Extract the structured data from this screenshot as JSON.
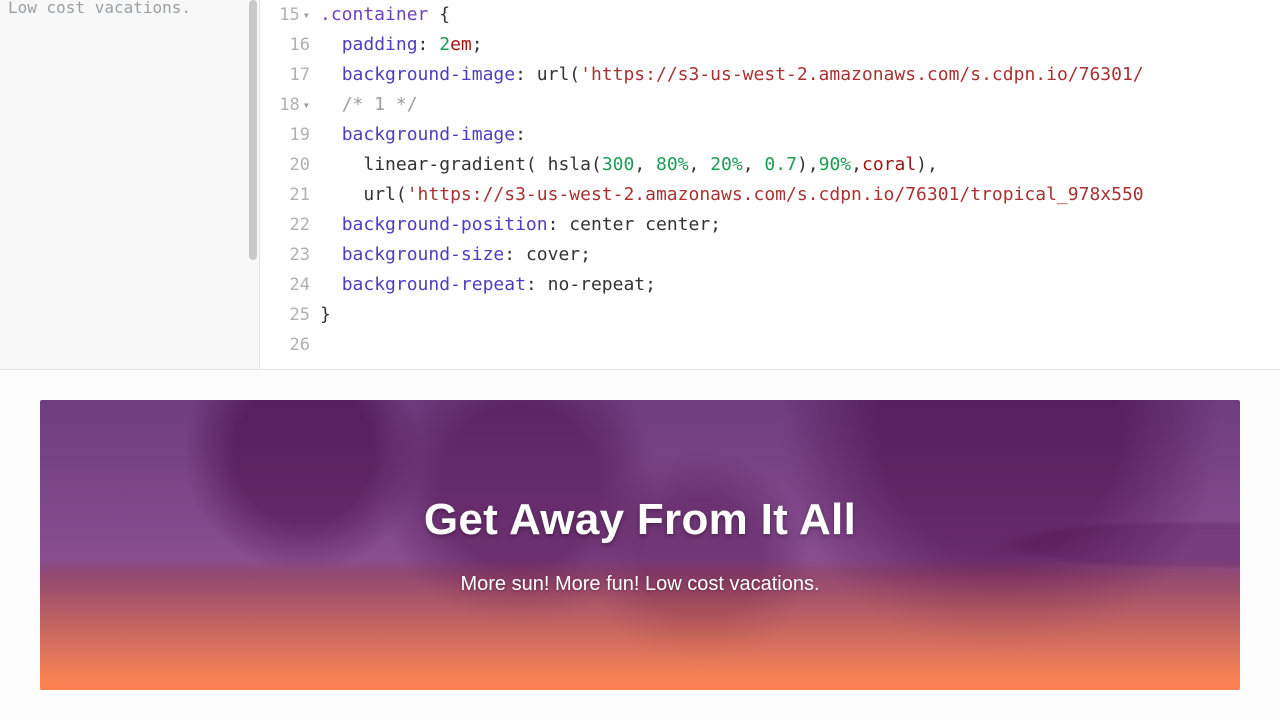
{
  "left_panel": {
    "visible_fragment": "Low cost vacations."
  },
  "editor": {
    "lines": [
      {
        "n": 15,
        "fold": true,
        "tokens": [
          [
            ".container",
            " sel"
          ],
          [
            " {",
            "punct"
          ]
        ]
      },
      {
        "n": 16,
        "fold": false,
        "tokens": [
          [
            "  ",
            ""
          ],
          [
            "padding",
            "prop"
          ],
          [
            ": ",
            "punct"
          ],
          [
            "2",
            "num"
          ],
          [
            "em",
            "unit"
          ],
          [
            ";",
            "punct"
          ]
        ]
      },
      {
        "n": 17,
        "fold": false,
        "tokens": [
          [
            "  ",
            ""
          ],
          [
            "background-image",
            "prop"
          ],
          [
            ": ",
            "punct"
          ],
          [
            "url",
            "fn"
          ],
          [
            "(",
            "punct"
          ],
          [
            "'https://s3-us-west-2.amazonaws.com/s.cdpn.io/76301/",
            "str"
          ]
        ]
      },
      {
        "n": 18,
        "fold": true,
        "tokens": [
          [
            "  ",
            ""
          ],
          [
            "/* 1 */",
            "comment"
          ]
        ]
      },
      {
        "n": 19,
        "fold": false,
        "tokens": [
          [
            "  ",
            ""
          ],
          [
            "background-image",
            "prop"
          ],
          [
            ":",
            "punct"
          ]
        ]
      },
      {
        "n": 20,
        "fold": false,
        "tokens": [
          [
            "    ",
            ""
          ],
          [
            "linear-gradient",
            "fn"
          ],
          [
            "( ",
            "punct"
          ],
          [
            "hsla",
            "fn"
          ],
          [
            "(",
            "punct"
          ],
          [
            "300",
            "num"
          ],
          [
            ", ",
            "punct"
          ],
          [
            "80%",
            "num"
          ],
          [
            ", ",
            "punct"
          ],
          [
            "20%",
            "num"
          ],
          [
            ", ",
            "punct"
          ],
          [
            "0.7",
            "num"
          ],
          [
            ")",
            "punct"
          ],
          [
            ",",
            "punct"
          ],
          [
            "90%",
            "num"
          ],
          [
            ",",
            "punct"
          ],
          [
            "coral",
            "val"
          ],
          [
            ")",
            "punct"
          ],
          [
            ",",
            "punct"
          ]
        ]
      },
      {
        "n": 21,
        "fold": false,
        "tokens": [
          [
            "    ",
            ""
          ],
          [
            "url",
            "fn"
          ],
          [
            "(",
            "punct"
          ],
          [
            "'https://s3-us-west-2.amazonaws.com/s.cdpn.io/76301/tropical_978x550",
            "str"
          ]
        ]
      },
      {
        "n": 22,
        "fold": false,
        "tokens": [
          [
            "  ",
            ""
          ],
          [
            "background-position",
            "prop"
          ],
          [
            ": ",
            "punct"
          ],
          [
            "center center",
            "plain"
          ],
          [
            ";",
            "punct"
          ]
        ]
      },
      {
        "n": 23,
        "fold": false,
        "tokens": [
          [
            "  ",
            ""
          ],
          [
            "background-size",
            "prop"
          ],
          [
            ": ",
            "punct"
          ],
          [
            "cover",
            "plain"
          ],
          [
            ";",
            "punct"
          ]
        ]
      },
      {
        "n": 24,
        "fold": false,
        "tokens": [
          [
            "  ",
            ""
          ],
          [
            "background-repeat",
            "prop"
          ],
          [
            ": ",
            "punct"
          ],
          [
            "no-repeat",
            "plain"
          ],
          [
            ";",
            "punct"
          ]
        ]
      },
      {
        "n": 25,
        "fold": false,
        "tokens": [
          [
            "}",
            "punct"
          ]
        ]
      },
      {
        "n": 26,
        "fold": false,
        "tokens": [
          [
            "",
            ""
          ]
        ]
      }
    ]
  },
  "preview": {
    "heading": "Get Away From It All",
    "subheading": "More sun! More fun! Low cost vacations."
  }
}
